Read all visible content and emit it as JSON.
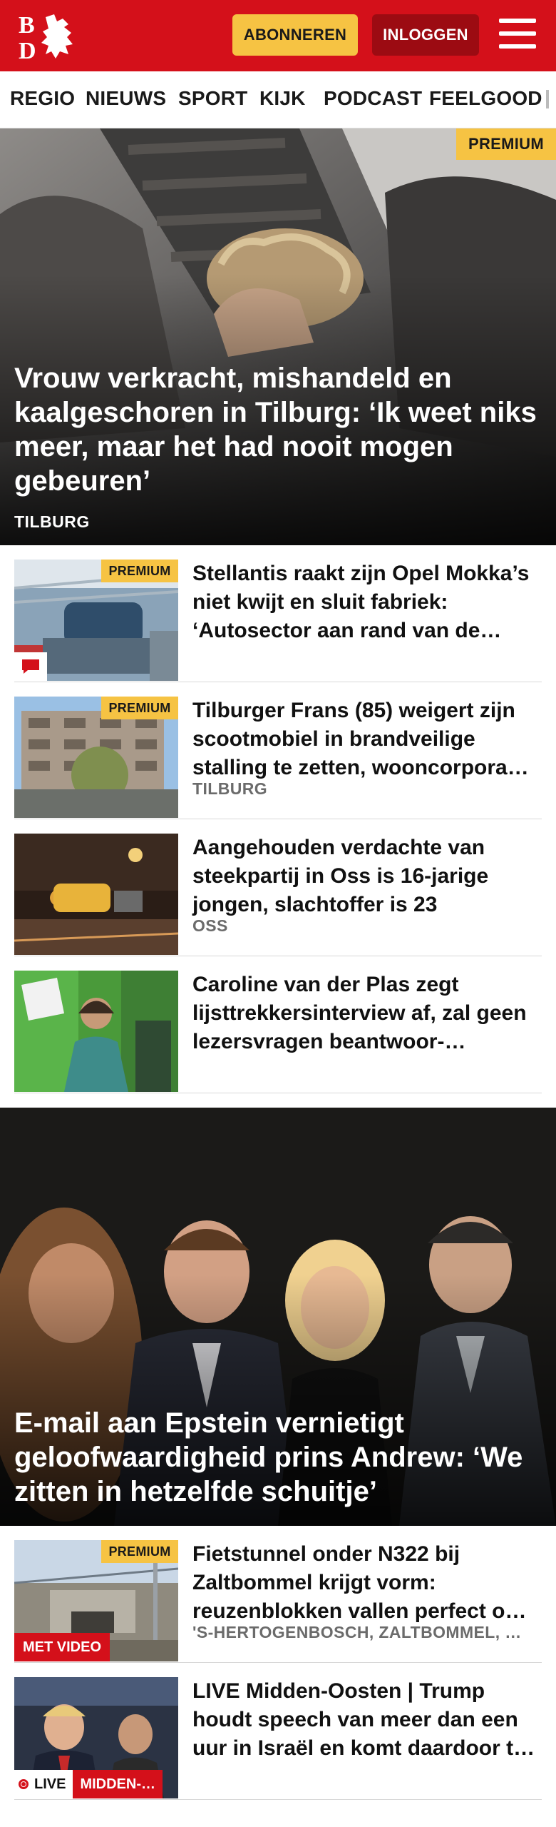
{
  "brand": {
    "logo_text": "BD",
    "red": "#d4101a",
    "yellow": "#f6c343"
  },
  "header": {
    "subscribe_label": "ABONNEREN",
    "login_label": "INLOGGEN",
    "menu_icon": "hamburger-menu-icon"
  },
  "nav": {
    "items": [
      "REGIO",
      "NIEUWS",
      "SPORT",
      "KIJK",
      "PODCAST",
      "FEELGOOD"
    ]
  },
  "hero1": {
    "badge": "PREMIUM",
    "title": "Vrouw verkracht, mishandeld en kaalgeschoren in Tilburg: ‘Ik weet niks meer, maar het had nooit mogen gebeuren’",
    "tag": "TILBURG"
  },
  "articles": [
    {
      "badge": "PREMIUM",
      "title": "Stellantis raakt zijn Opel Mokka’s niet kwijt en sluit fabriek: ‘Autosector aan rand van de…",
      "tag": "",
      "icon": "comment-icon"
    },
    {
      "badge": "PREMIUM",
      "title": "Tilburger Frans (85) weigert zijn scootmobiel in brandveilige stalling te zetten, wooncorpora…",
      "tag": "TILBURG"
    },
    {
      "badge": "",
      "title": "Aangehouden verdachte van steekpartij in Oss is 16-jarige jongen, slachtoffer is 23",
      "tag": "OSS"
    },
    {
      "badge": "",
      "title": "Caroline van der Plas zegt lijsttrekkersinterview af, zal geen lezersvragen beantwoor-…",
      "tag": ""
    }
  ],
  "hero2": {
    "title": "E-mail aan Epstein vernietigt geloofwaardigheid prins Andrew: ‘We zitten in hetzelfde schuitje’"
  },
  "articles2": [
    {
      "badge": "PREMIUM",
      "video": "MET VIDEO",
      "title": "Fietstunnel onder N322 bij Zaltbommel krijgt vorm: reuzenblokken vallen perfect o…",
      "tag": "'S-HERTOGENBOSCH, ZALTBOMMEL, …"
    },
    {
      "live": "LIVE",
      "section": "MIDDEN-…",
      "title": "LIVE Midden-Oosten | Trump houdt speech van meer dan een uur in Israël en komt daardoor t…",
      "tag": ""
    }
  ]
}
